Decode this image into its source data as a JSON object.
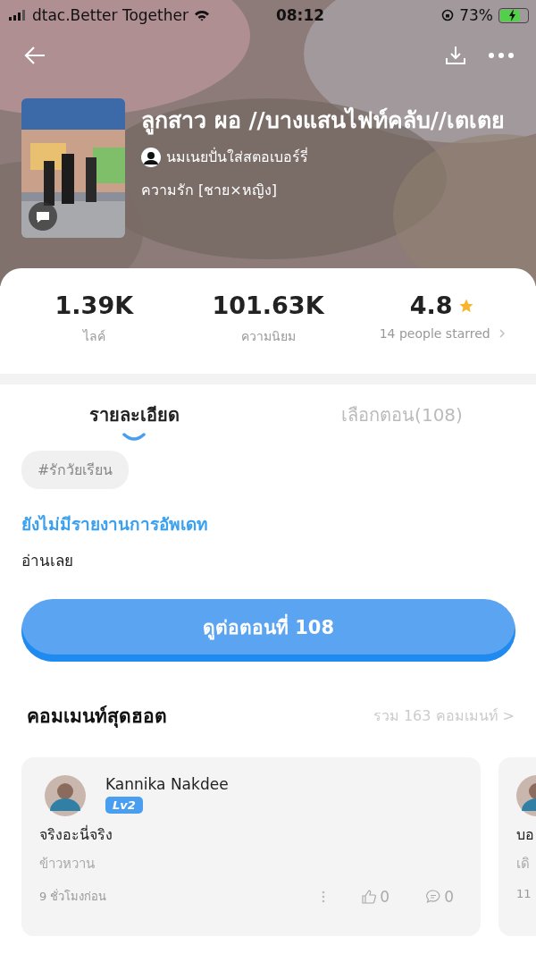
{
  "status_bar": {
    "carrier": "dtac.Better Together",
    "time": "08:12",
    "battery": "73%",
    "charging": true
  },
  "book": {
    "title": "ลูกสาว ผอ //บางแสนไฟท์คลับ//เตเตย",
    "author": "นมเนยปั่นใส่สตอเบอร์รี่",
    "genre": "ความรัก [ชาย×หญิง]"
  },
  "stats": [
    {
      "kind": "count",
      "value": "1.39K",
      "label": "ไลค์"
    },
    {
      "kind": "count",
      "value": "101.63K",
      "label": "ความนิยม"
    },
    {
      "kind": "rating",
      "value": "4.8",
      "label": "14 people starred"
    }
  ],
  "tabs": [
    {
      "label": "รายละเอียด",
      "selected": true
    },
    {
      "label": "เลือกตอน(108)",
      "selected": false
    }
  ],
  "tags": [
    "#รักวัยเรียน"
  ],
  "update_note": "ยังไม่มีรายงานการอัพเดท",
  "read_label": "อ่านเลย",
  "continue_button": "ดูต่อตอนที่ 108",
  "comments_section": {
    "title": "คอมเมนท์สุดฮอต",
    "total": "รวม 163 คอมเมนท์ >"
  },
  "comments": [
    {
      "user": "Kannika Nakdee",
      "level": "Lv2",
      "text": "จริงอะนี่จริง",
      "subtext": "ข้าวหวาน",
      "time": "9 ชั่วโมงก่อน",
      "likes": "0",
      "replies": "0"
    },
    {
      "text": "บอ",
      "subtext": "เดิ",
      "time": "11"
    }
  ]
}
